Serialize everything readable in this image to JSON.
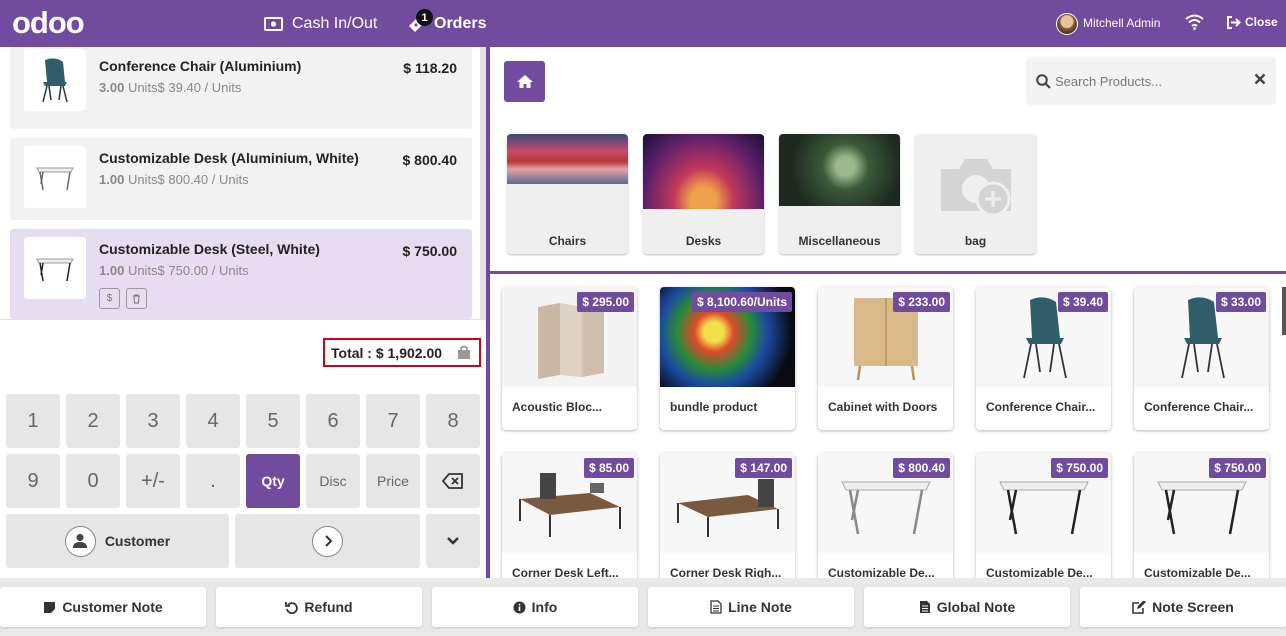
{
  "topbar": {
    "logo": "odoo",
    "cash_label": "Cash In/Out",
    "orders_label": "Orders",
    "orders_count": "1",
    "user_name": "Mitchell Admin",
    "close_label": "Close"
  },
  "orderlines": [
    {
      "name": "Conference Chair (Aluminium)",
      "price": "$ 118.20",
      "qty": "3.00",
      "unit_detail": "Units$ 39.40 / Units"
    },
    {
      "name": "Customizable Desk (Aluminium, White)",
      "price": "$ 800.40",
      "qty": "1.00",
      "unit_detail": "Units$ 800.40 / Units"
    },
    {
      "name": "Customizable Desk (Steel, White)",
      "price": "$ 750.00",
      "qty": "1.00",
      "unit_detail": "Units$ 750.00 / Units"
    }
  ],
  "total": "Total : $ 1,902.00",
  "numpad": {
    "row1": [
      "1",
      "2",
      "3",
      "4",
      "5",
      "6",
      "7",
      "8"
    ],
    "row2": [
      "9",
      "0",
      "+/-",
      ".",
      "Qty",
      "Disc",
      "Price"
    ],
    "customer_label": "Customer"
  },
  "search": {
    "placeholder": "Search Products..."
  },
  "categories": [
    {
      "label": "Chairs"
    },
    {
      "label": "Desks"
    },
    {
      "label": "Miscellaneous"
    },
    {
      "label": "bag"
    }
  ],
  "products": [
    {
      "name": "Acoustic Bloc...",
      "price": "$ 295.00"
    },
    {
      "name": "bundle product",
      "price": "$ 8,100.60/Units"
    },
    {
      "name": "Cabinet with Doors",
      "price": "$ 233.00"
    },
    {
      "name": "Conference Chair...",
      "price": "$ 39.40"
    },
    {
      "name": "Conference Chair...",
      "price": "$ 33.00"
    },
    {
      "name": "Corner Desk Left...",
      "price": "$ 85.00"
    },
    {
      "name": "Corner Desk Righ...",
      "price": "$ 147.00"
    },
    {
      "name": "Customizable De...",
      "price": "$ 800.40"
    },
    {
      "name": "Customizable De...",
      "price": "$ 750.00"
    },
    {
      "name": "Customizable De...",
      "price": "$ 750.00"
    }
  ],
  "bottom": {
    "customer_note": "Customer Note",
    "refund": "Refund",
    "info": "Info",
    "line_note": "Line Note",
    "global_note": "Global Note",
    "note_screen": "Note Screen"
  },
  "colors": {
    "accent": "#714b9e",
    "total_border": "#d0021b"
  }
}
